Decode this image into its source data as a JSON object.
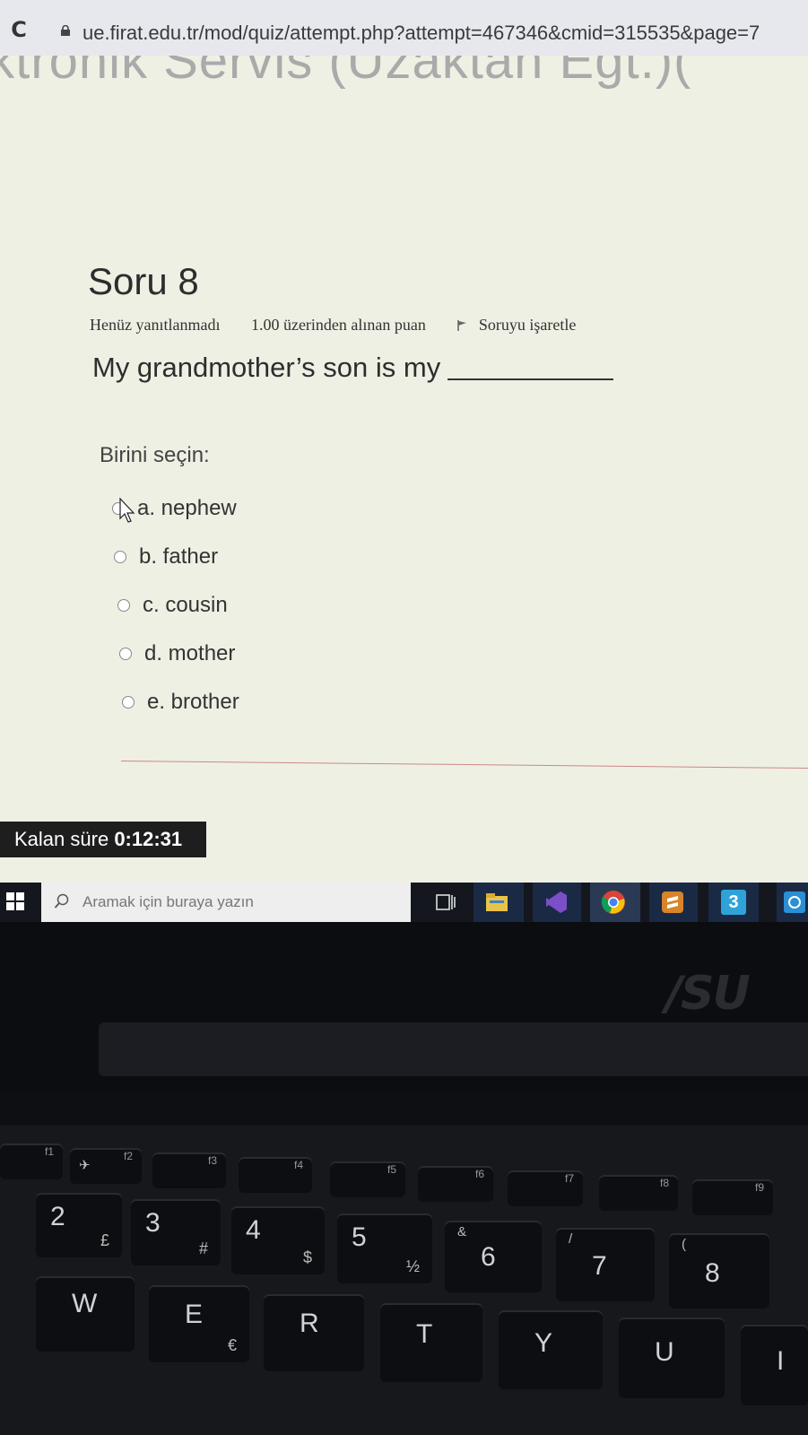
{
  "browser": {
    "url": "ue.firat.edu.tr/mod/quiz/attempt.php?attempt=467346&cmid=315535&page=7"
  },
  "course": {
    "header_fragment": "iektronik Servis (Uzaktan Eğt.)("
  },
  "question": {
    "title": "Soru 8",
    "status": "Henüz yanıtlanmadı",
    "points": "1.00 üzerinden alınan puan",
    "flag_label": "Soruyu işaretle",
    "text": "My grandmother’s son is my",
    "prompt": "Birini seçin:",
    "options": [
      {
        "label": "a. nephew"
      },
      {
        "label": "b. father"
      },
      {
        "label": "c. cousin"
      },
      {
        "label": "d. mother"
      },
      {
        "label": "e. brother"
      }
    ]
  },
  "timer": {
    "label": "Kalan süre",
    "value": "0:12:31"
  },
  "taskbar": {
    "search_placeholder": "Aramak için buraya yazın",
    "icons": [
      "task-view-icon",
      "file-explorer-icon",
      "visual-studio-icon",
      "chrome-icon",
      "sublime-icon",
      "app-3-icon",
      "app-edge-icon"
    ],
    "badge_text": "3"
  },
  "laptop": {
    "brand": "/SU",
    "keys": {
      "f1": "f1",
      "f2": "f2",
      "f3": "f3",
      "f4": "f4",
      "f5": "f5",
      "f6": "f6",
      "f7": "f7",
      "f8": "f8",
      "f9": "f9",
      "k2": "2",
      "k2sub": "£",
      "k3": "3",
      "k3sub": "#",
      "k4": "4",
      "k4sub": "$",
      "k5": "5",
      "k5sub": "½",
      "k6": "6",
      "k6top": "&",
      "k7": "7",
      "k7top": "/",
      "k8": "8",
      "k8top": "(",
      "w": "W",
      "e": "E",
      "esub": "€",
      "r": "R",
      "t": "T",
      "y": "Y",
      "u": "U",
      "i": "I"
    }
  },
  "colors": {
    "page_bg": "#eef0e4",
    "timer_bg": "#1e1e1e",
    "taskbar_bg": "#15171f",
    "divider": "#cc8888"
  }
}
